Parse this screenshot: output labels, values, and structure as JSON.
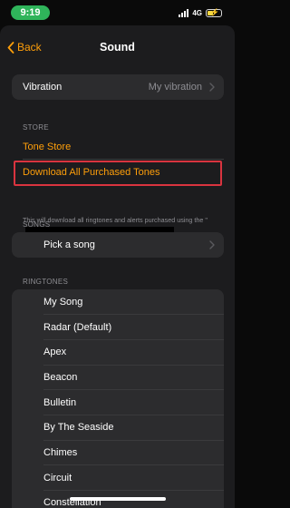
{
  "status_bar": {
    "time": "9:19",
    "network": "4G"
  },
  "nav": {
    "back_label": "Back",
    "title": "Sound"
  },
  "vibration_row": {
    "label": "Vibration",
    "value": "My vibration"
  },
  "store": {
    "header": "STORE",
    "tone_store": "Tone Store",
    "download_all": "Download All Purchased Tones",
    "footnote": "This will download all ringtones and alerts purchased using the \""
  },
  "songs": {
    "header": "SONGS",
    "pick": "Pick a song"
  },
  "ringtones": {
    "header": "RINGTONES",
    "items": [
      {
        "label": "My Song"
      },
      {
        "label": "Radar (Default)"
      },
      {
        "label": "Apex"
      },
      {
        "label": "Beacon"
      },
      {
        "label": "Bulletin"
      },
      {
        "label": "By The Seaside"
      },
      {
        "label": "Chimes"
      },
      {
        "label": "Circuit"
      },
      {
        "label": "Constellation"
      }
    ]
  },
  "colors": {
    "accent": "#ff9f0a",
    "time_pill": "#2fb45a",
    "highlight_border": "#d9343f",
    "cell": "#2c2c2e",
    "background": "#1c1c1e"
  },
  "icons": {
    "back": "chevron-left-icon",
    "disclosure": "chevron-right-icon",
    "signal": "signal-bars-icon",
    "battery": "battery-charging-icon"
  }
}
